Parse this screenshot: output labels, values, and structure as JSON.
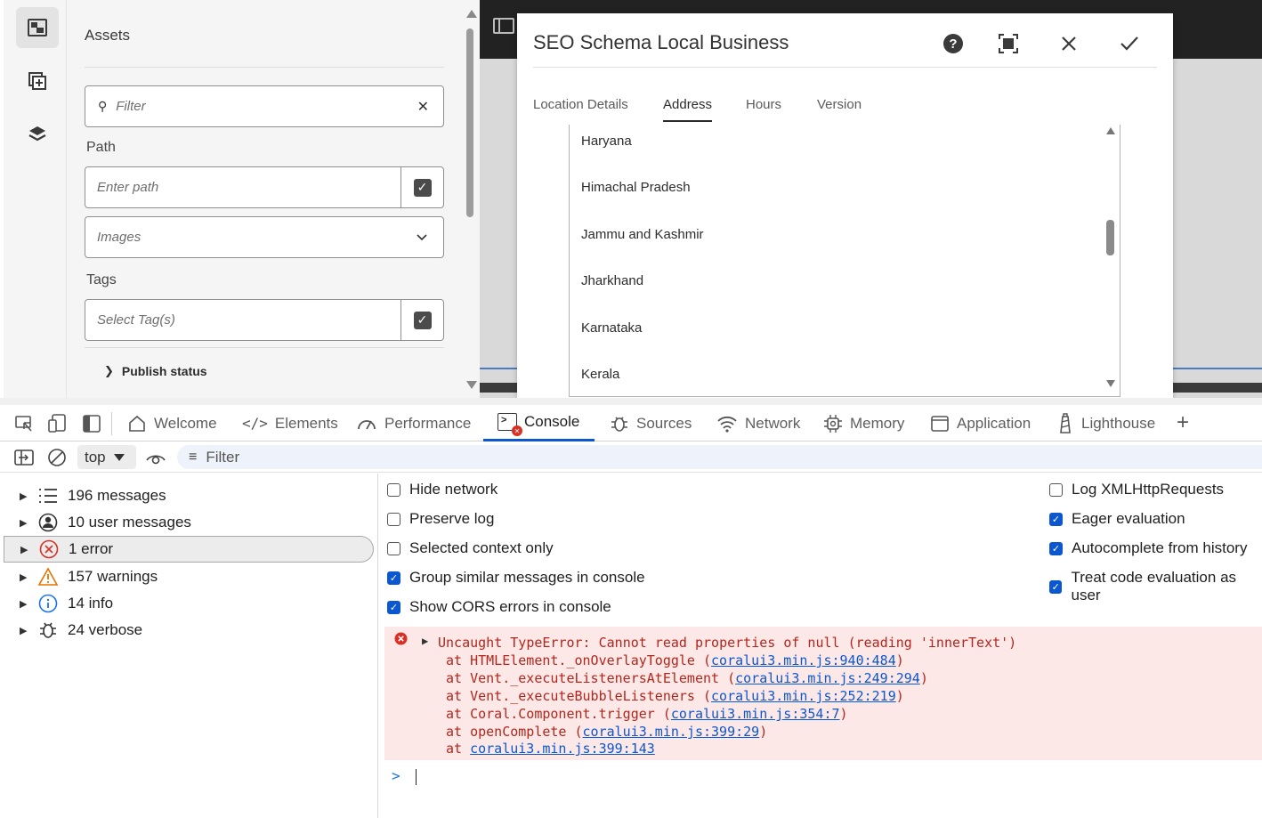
{
  "assets_panel": {
    "title": "Assets",
    "filter_placeholder": "Filter",
    "path_label": "Path",
    "path_placeholder": "Enter path",
    "type_select_value": "Images",
    "tags_label": "Tags",
    "tags_placeholder": "Select Tag(s)",
    "publish_status_label": "Publish status"
  },
  "dialog": {
    "title": "SEO Schema Local Business",
    "tabs": [
      "Location Details",
      "Address",
      "Hours",
      "Version"
    ],
    "active_tab": "Address",
    "list_items": [
      "Haryana",
      "Himachal Pradesh",
      "Jammu and Kashmir",
      "Jharkhand",
      "Karnataka",
      "Kerala"
    ]
  },
  "devtools": {
    "tabs": [
      "Welcome",
      "Elements",
      "Performance",
      "Console",
      "Sources",
      "Network",
      "Memory",
      "Application",
      "Lighthouse"
    ],
    "active_tab": "Console",
    "context_select": "top",
    "filter_placeholder": "Filter",
    "sidebar": [
      {
        "label": "196 messages",
        "icon": "list-icon"
      },
      {
        "label": "10 user messages",
        "icon": "user-icon"
      },
      {
        "label": "1 error",
        "icon": "error-icon"
      },
      {
        "label": "157 warnings",
        "icon": "warning-icon"
      },
      {
        "label": "14 info",
        "icon": "info-icon"
      },
      {
        "label": "24 verbose",
        "icon": "bug-icon"
      }
    ],
    "settings_left": [
      {
        "label": "Hide network",
        "checked": false
      },
      {
        "label": "Preserve log",
        "checked": false
      },
      {
        "label": "Selected context only",
        "checked": false
      },
      {
        "label": "Group similar messages in console",
        "checked": true
      },
      {
        "label": "Show CORS errors in console",
        "checked": true
      }
    ],
    "settings_right": [
      {
        "label": "Log XMLHttpRequests",
        "checked": false
      },
      {
        "label": "Eager evaluation",
        "checked": true
      },
      {
        "label": "Autocomplete from history",
        "checked": true
      },
      {
        "label": "Treat code evaluation as user",
        "checked": true
      }
    ],
    "error": {
      "message": "Uncaught TypeError: Cannot read properties of null (reading 'innerText')",
      "stack": [
        {
          "prefix": "at HTMLElement._onOverlayToggle (",
          "link": "coralui3.min.js:940:484",
          "suffix": ")"
        },
        {
          "prefix": "at Vent._executeListenersAtElement (",
          "link": "coralui3.min.js:249:294",
          "suffix": ")"
        },
        {
          "prefix": "at Vent._executeBubbleListeners (",
          "link": "coralui3.min.js:252:219",
          "suffix": ")"
        },
        {
          "prefix": "at Coral.Component.trigger (",
          "link": "coralui3.min.js:354:7",
          "suffix": ")"
        },
        {
          "prefix": "at openComplete (",
          "link": "coralui3.min.js:399:29",
          "suffix": ")"
        },
        {
          "prefix": "at ",
          "link": "coralui3.min.js:399:143",
          "suffix": ""
        }
      ]
    },
    "prompt_symbol": ">"
  },
  "colors": {
    "accent": "#0b57d0",
    "error_bg": "#fce8e6",
    "error_text": "#b3261e"
  }
}
